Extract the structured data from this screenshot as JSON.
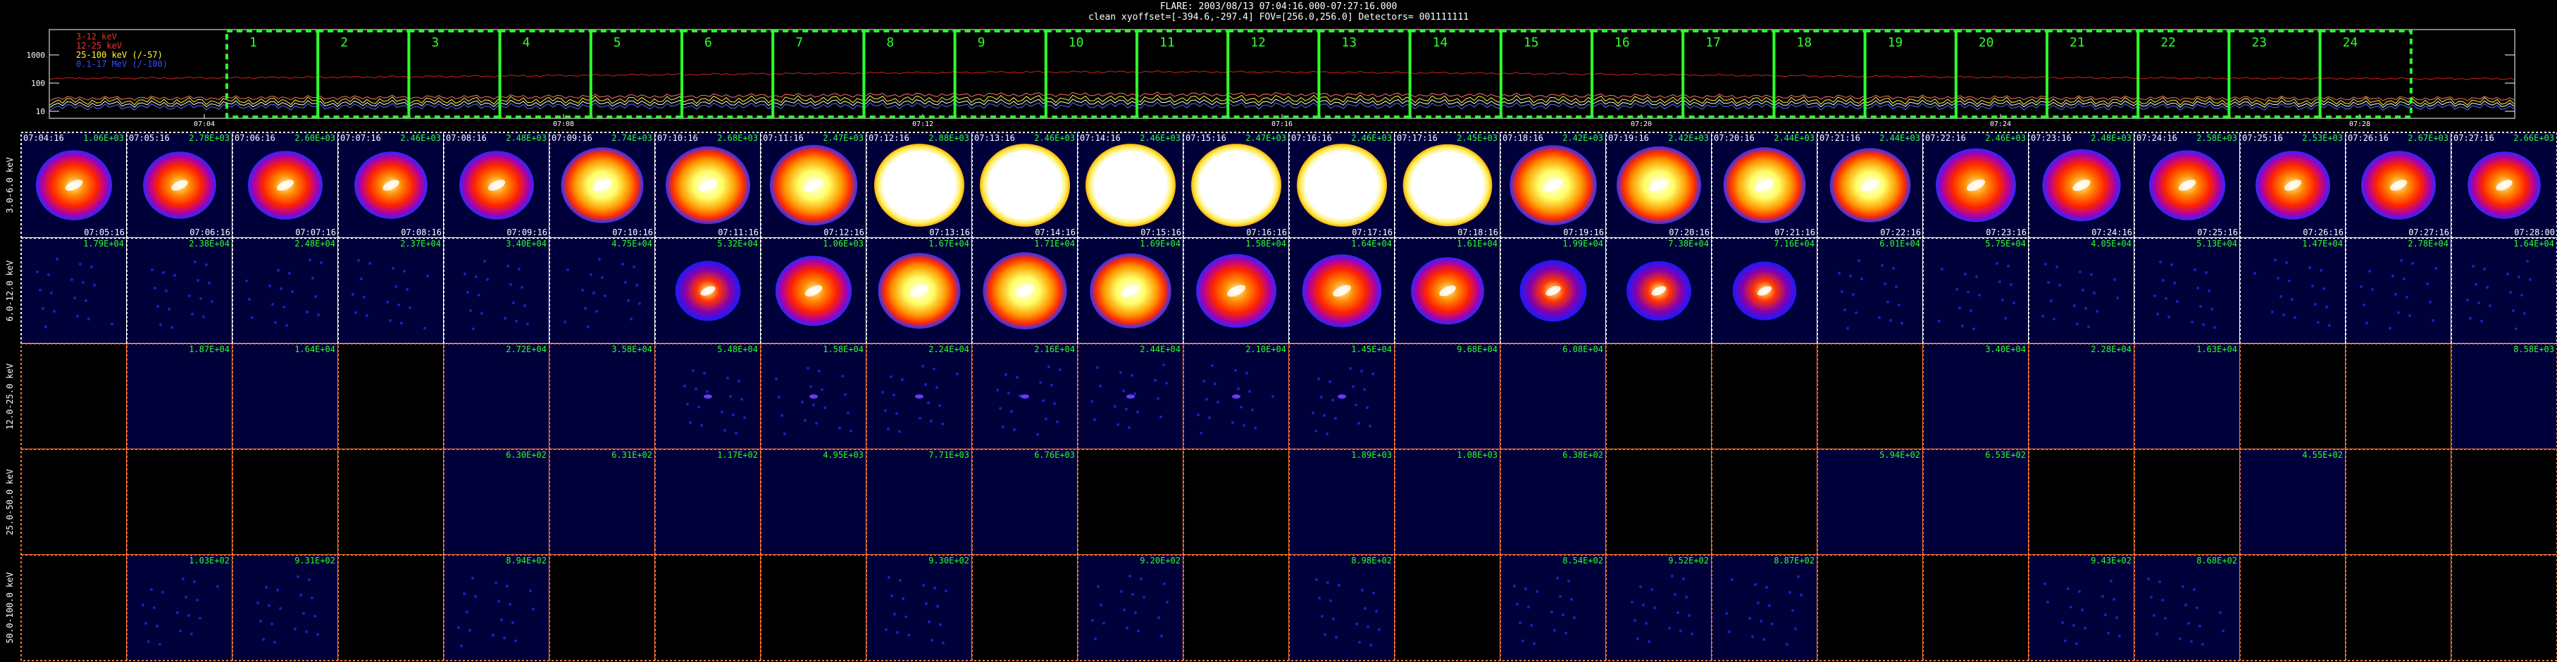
{
  "header": {
    "line1": "FLARE: 2003/08/13 07:04:16.000-07:27:16.000",
    "line2": "clean    xyoffset=[-394.6,-297.4]    FOV=[256.0,256.0]    Detectors= 001111111"
  },
  "lightcurve": {
    "legend": [
      {
        "label": "3-12 keV",
        "color": "#e03a1a"
      },
      {
        "label": "12-25 keV",
        "color": "#ff3030"
      },
      {
        "label": "25-100 keV (/-57)",
        "color": "#ffff33"
      },
      {
        "label": "0.1-17 MeV (/-100)",
        "color": "#3a4cff"
      }
    ],
    "yticks": [
      "1000",
      "100",
      "10"
    ],
    "xticks": [
      "07:04",
      "07:08",
      "07:12",
      "07:16",
      "07:20",
      "07:24",
      "07:28"
    ],
    "intervals": [
      "1",
      "2",
      "3",
      "4",
      "5",
      "6",
      "7",
      "8",
      "9",
      "10",
      "11",
      "12",
      "13",
      "14",
      "15",
      "16",
      "17",
      "18",
      "19",
      "20",
      "21",
      "22",
      "23",
      "24"
    ]
  },
  "chart_data": {
    "type": "heatmap",
    "title": "FLARE: 2003/08/13 07:04:16.000-07:27:16.000",
    "row_labels": [
      "3.0-6.0 keV",
      "6.0-12.0 keV",
      "12.0-25.0 keV",
      "25.0-50.0 keV",
      "50.0-100.0 keV"
    ],
    "start_times": [
      "07:04:16",
      "07:05:16",
      "07:06:16",
      "07:07:16",
      "07:08:16",
      "07:09:16",
      "07:10:16",
      "07:11:16",
      "07:12:16",
      "07:13:16",
      "07:14:16",
      "07:15:16",
      "07:16:16",
      "07:17:16",
      "07:18:16",
      "07:19:16",
      "07:20:16",
      "07:21:16",
      "07:22:16",
      "07:23:16",
      "07:24:16",
      "07:25:16",
      "07:26:16",
      "07:27:16"
    ],
    "end_times": [
      "07:05:16",
      "07:06:16",
      "07:07:16",
      "07:08:16",
      "07:09:16",
      "07:10:16",
      "07:11:16",
      "07:12:16",
      "07:13:16",
      "07:14:16",
      "07:15:16",
      "07:16:16",
      "07:17:16",
      "07:18:16",
      "07:19:16",
      "07:20:16",
      "07:21:16",
      "07:22:16",
      "07:23:16",
      "07:24:16",
      "07:25:16",
      "07:26:16",
      "07:27:16",
      "07:28:00"
    ],
    "max_values": [
      [
        "1.06E+03",
        "2.78E+03",
        "2.60E+03",
        "2.46E+03",
        "2.48E+03",
        "2.74E+03",
        "2.68E+03",
        "2.47E+03",
        "2.88E+03",
        "2.46E+03",
        "2.46E+03",
        "2.47E+03",
        "2.46E+03",
        "2.45E+03",
        "2.42E+03",
        "2.42E+03",
        "2.44E+03",
        "2.44E+03",
        "2.46E+03",
        "2.48E+03",
        "2.58E+03",
        "2.53E+03",
        "2.67E+03",
        "2.66E+03"
      ],
      [
        "1.79E+04",
        "2.38E+04",
        "2.48E+04",
        "2.37E+04",
        "3.40E+04",
        "4.75E+04",
        "5.32E+04",
        "1.06E+03",
        "1.67E+04",
        "1.71E+04",
        "1.69E+04",
        "1.58E+04",
        "1.64E+04",
        "1.61E+04",
        "1.99E+04",
        "7.38E+04",
        "7.16E+04",
        "6.01E+04",
        "5.75E+04",
        "4.05E+04",
        "5.13E+04",
        "1.47E+04",
        "2.78E+04",
        "1.64E+04"
      ],
      [
        "",
        "1.87E+04",
        "1.64E+04",
        "",
        "2.72E+04",
        "3.58E+04",
        "5.48E+04",
        "1.58E+04",
        "2.24E+04",
        "2.16E+04",
        "2.44E+04",
        "2.10E+04",
        "1.45E+04",
        "9.68E+04",
        "6.08E+04",
        "",
        "",
        "",
        "3.40E+04",
        "2.28E+04",
        "1.63E+04",
        "",
        "",
        "8.58E+03"
      ],
      [
        "",
        "",
        "",
        "",
        "6.30E+02",
        "6.31E+02",
        "1.17E+02",
        "4.95E+03",
        "7.71E+03",
        "6.76E+03",
        "",
        "",
        "1.89E+03",
        "1.08E+03",
        "6.38E+02",
        "",
        "",
        "5.94E+02",
        "6.53E+02",
        "",
        "",
        "4.55E+02",
        "",
        ""
      ],
      [
        "",
        "1.03E+02",
        "9.31E+02",
        "",
        "8.94E+02",
        "",
        "",
        "",
        "9.30E+02",
        "",
        "9.20E+02",
        "",
        "8.98E+02",
        "",
        "8.54E+02",
        "9.52E+02",
        "8.87E+02",
        "",
        "",
        "9.43E+02",
        "8.68E+02",
        "",
        "",
        ""
      ]
    ],
    "intensity": [
      [
        0.55,
        0.45,
        0.5,
        0.45,
        0.5,
        0.75,
        0.82,
        0.92,
        1.0,
        1.0,
        1.0,
        1.0,
        1.0,
        0.97,
        0.9,
        0.82,
        0.75,
        0.7,
        0.68,
        0.62,
        0.55,
        0.5,
        0.5,
        0.45
      ],
      [
        0.04,
        0.04,
        0.04,
        0.04,
        0.05,
        0.08,
        0.2,
        0.55,
        0.75,
        0.8,
        0.72,
        0.68,
        0.65,
        0.45,
        0.25,
        0.18,
        0.15,
        0.08,
        0.06,
        0.04,
        0.03,
        0.02,
        0.02,
        0.02
      ],
      [
        0.0,
        0.0,
        0.0,
        0.0,
        0.0,
        0.0,
        0.01,
        0.01,
        0.03,
        0.02,
        0.02,
        0.01,
        0.01,
        0.0,
        0.0,
        0.0,
        0.0,
        0.0,
        0.0,
        0.0,
        0.0,
        0.0,
        0.0,
        0.0
      ],
      [
        0.0,
        0.0,
        0.0,
        0.0,
        0.0,
        0.0,
        0.0,
        0.0,
        0.0,
        0.0,
        0.0,
        0.0,
        0.0,
        0.0,
        0.0,
        0.0,
        0.0,
        0.0,
        0.0,
        0.0,
        0.0,
        0.0,
        0.0,
        0.0
      ],
      [
        0.0,
        0.06,
        0.05,
        0.0,
        0.05,
        0.0,
        0.0,
        0.0,
        0.05,
        0.0,
        0.05,
        0.0,
        0.05,
        0.0,
        0.05,
        0.05,
        0.05,
        0.0,
        0.0,
        0.05,
        0.05,
        0.0,
        0.0,
        0.0
      ]
    ]
  }
}
